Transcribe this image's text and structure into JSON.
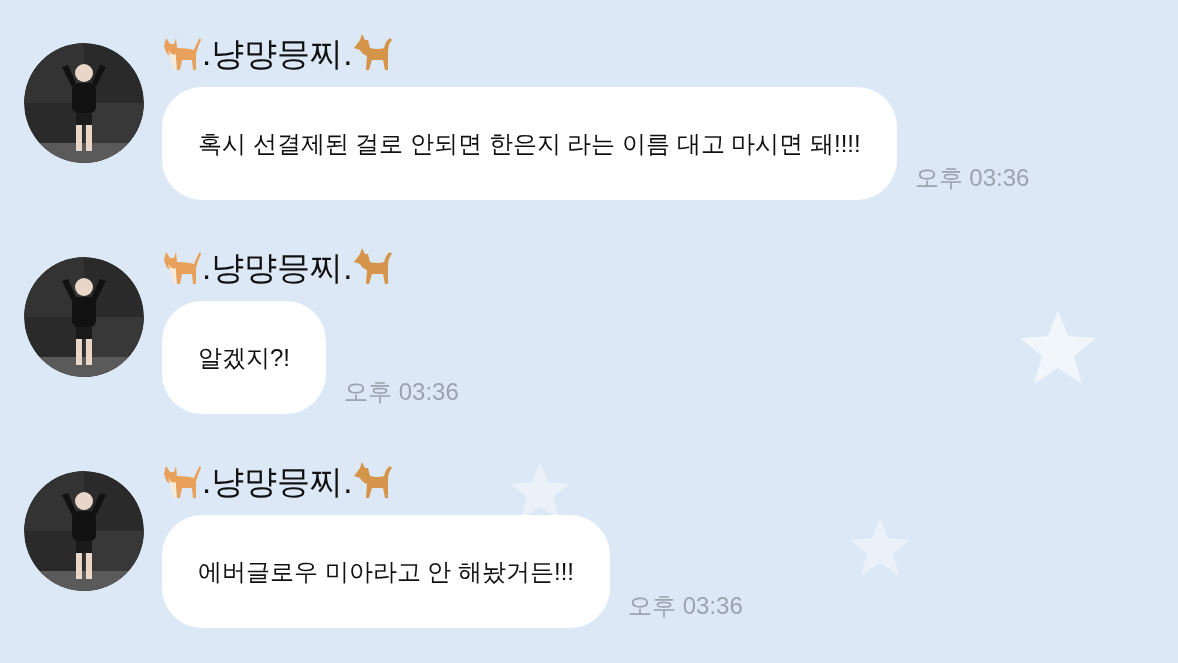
{
  "messages": [
    {
      "sender": ".냥먕믕찌.",
      "text": "혹시 선결제된 걸로 안되면 한은지 라는 이름 대고 마시면 돼!!!!",
      "time": "오후 03:36"
    },
    {
      "sender": ".냥먕믕찌.",
      "text": "알겠지?!",
      "time": "오후 03:36"
    },
    {
      "sender": ".냥먕믕찌.",
      "text": "에버글로우 미아라고 안 해놨거든!!!",
      "time": "오후 03:36"
    }
  ]
}
